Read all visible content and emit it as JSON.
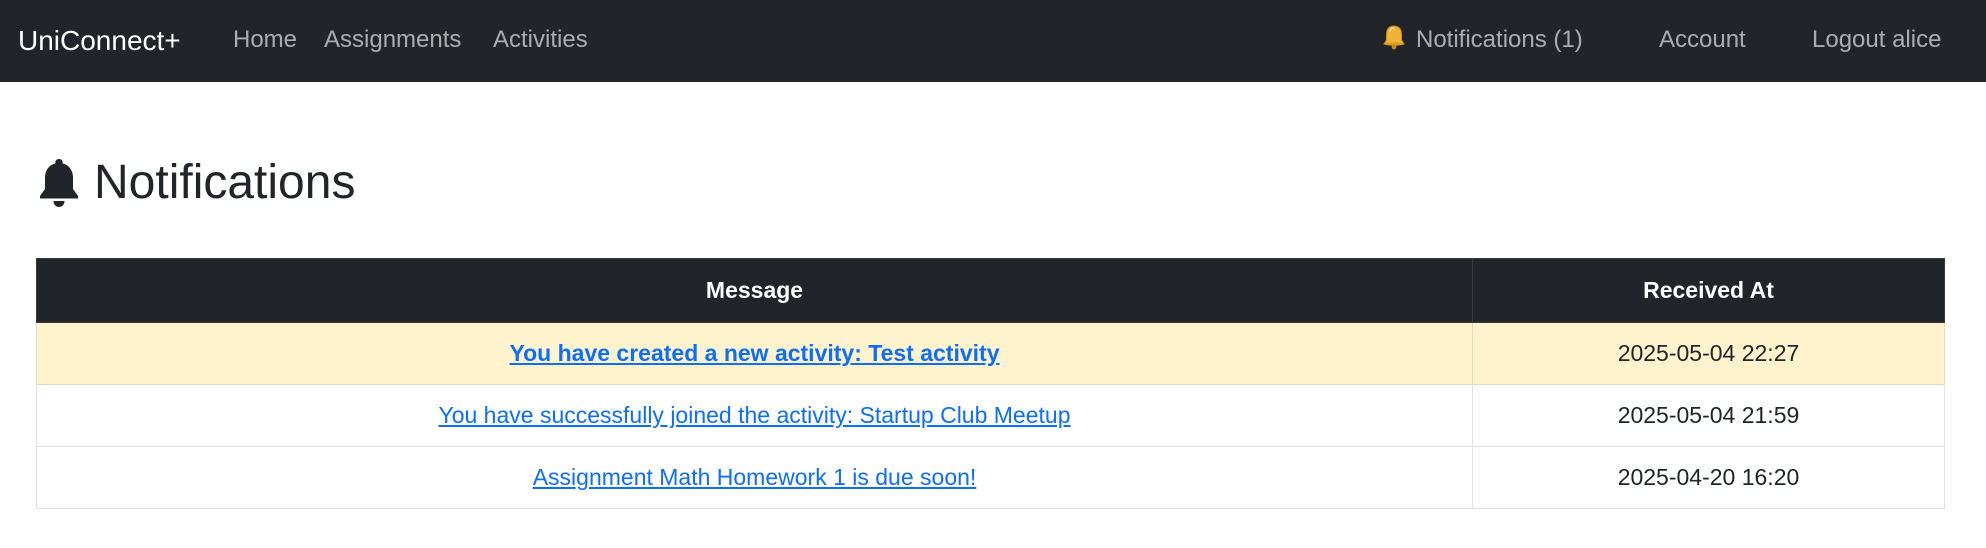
{
  "navbar": {
    "brand": "UniConnect+",
    "links": {
      "home": "Home",
      "assignments": "Assignments",
      "activities": "Activities"
    },
    "right": {
      "notifications": "Notifications (1)",
      "account": "Account",
      "logout": "Logout alice"
    },
    "background_color": "#212529",
    "bell_icon": "bell-emoji-icon"
  },
  "page": {
    "title": "Notifications",
    "title_icon": "bell-icon"
  },
  "table": {
    "headers": {
      "message": "Message",
      "received_at": "Received At"
    },
    "rows": [
      {
        "message": "You have created a new activity: Test activity",
        "received_at": "2025-05-04 22:27",
        "unread": true
      },
      {
        "message": "You have successfully joined the activity: Startup Club Meetup",
        "received_at": "2025-05-04 21:59",
        "unread": false
      },
      {
        "message": "Assignment Math Homework 1 is due soon!",
        "received_at": "2025-04-20 16:20",
        "unread": false
      }
    ],
    "header_color": "#212529",
    "unread_row_color": "#fff3cd",
    "link_color": "#0d6efd"
  }
}
